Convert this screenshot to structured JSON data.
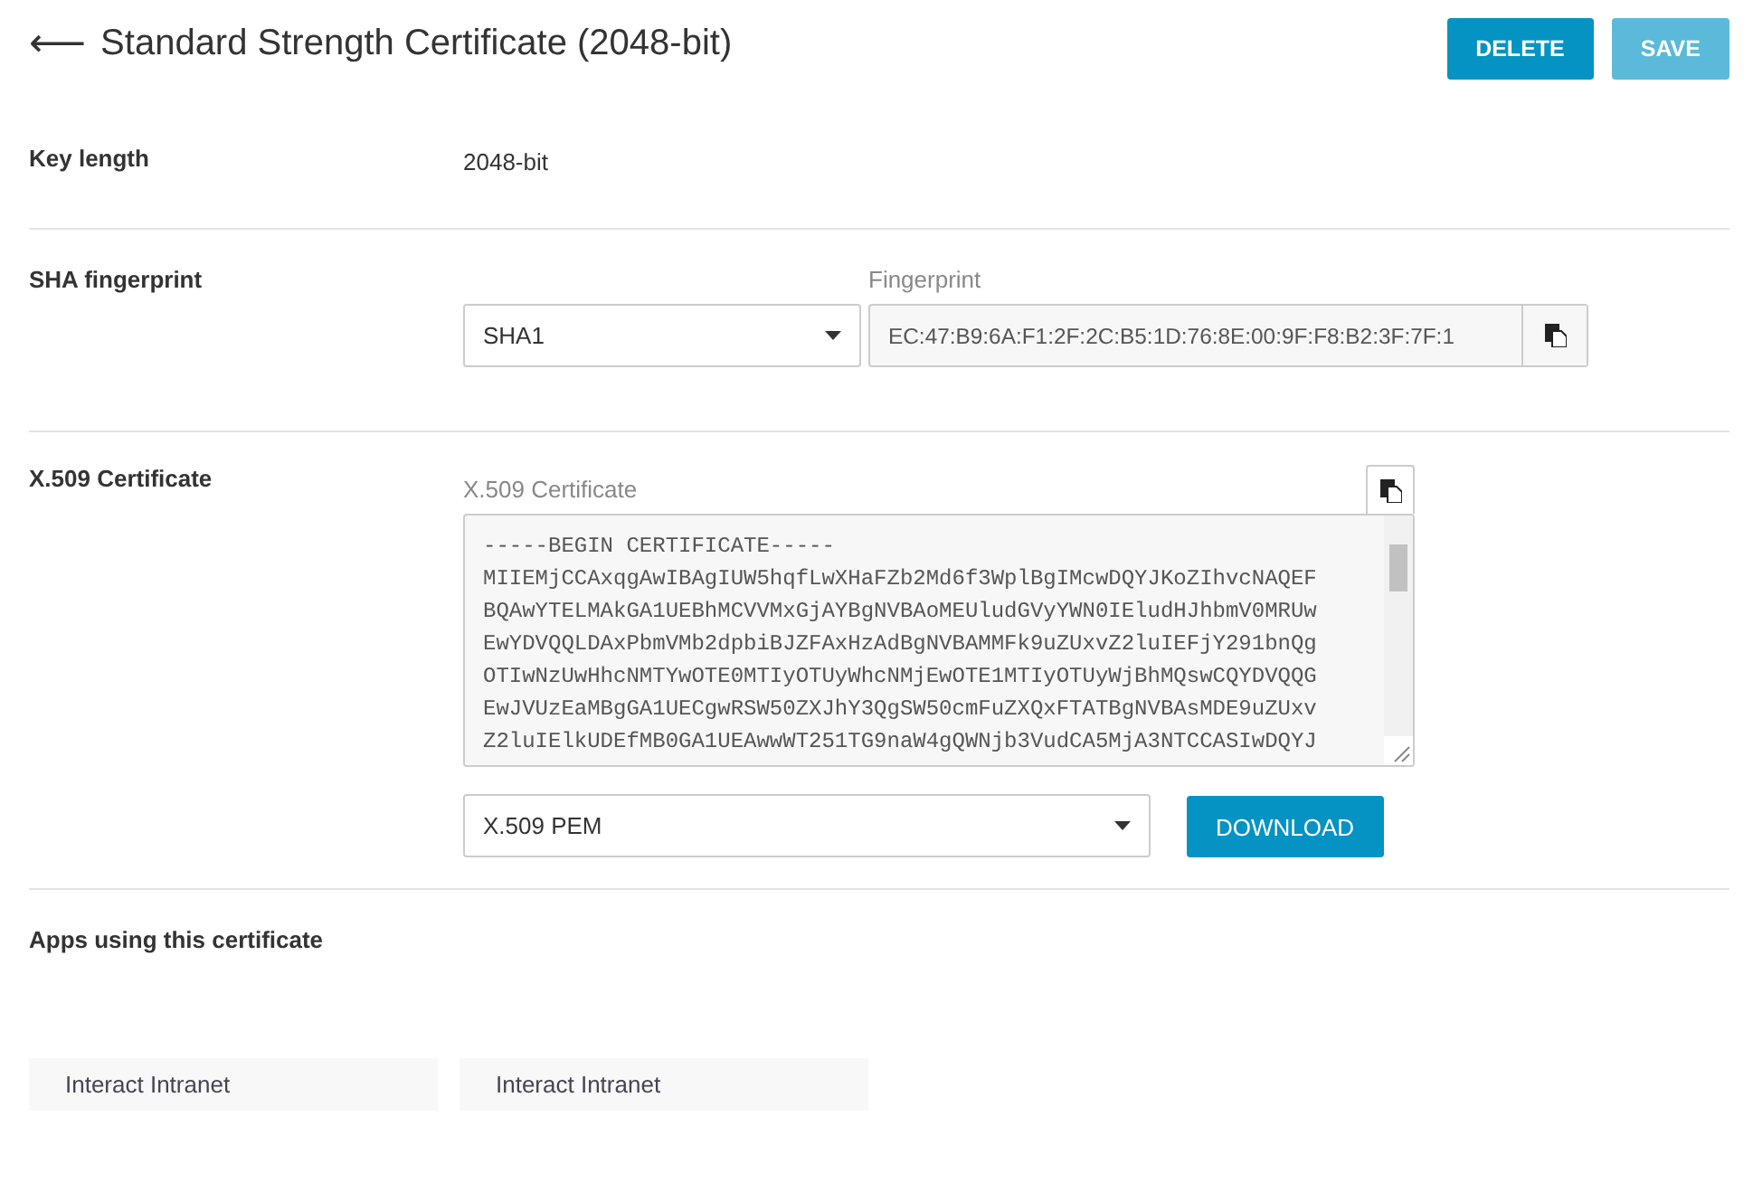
{
  "header": {
    "back_icon": "⟵",
    "title": "Standard Strength Certificate (2048-bit)",
    "buttons": [
      {
        "label": "DELETE",
        "disabled": false
      },
      {
        "label": "SAVE",
        "disabled": true
      }
    ]
  },
  "key_length": {
    "label": "Key length",
    "value": "2048-bit"
  },
  "sha": {
    "label": "SHA fingerprint",
    "algorithm": "SHA1",
    "field_label": "Fingerprint",
    "value": "EC:47:B9:6A:F1:2F:2C:B5:1D:76:8E:00:9F:F8:B2:3F:7F:1"
  },
  "certificate": {
    "label": "X.509 Certificate",
    "field_label": "X.509 Certificate",
    "lines": [
      "-----BEGIN CERTIFICATE-----",
      "MIIEMjCCAxqgAwIBAgIUW5hqfLwXHaFZb2Md6f3WplBgIMcwDQYJKoZIhvcNAQEF",
      "BQAwYTELMAkGA1UEBhMCVVMxGjAYBgNVBAoMEUludGVyYWN0IEludHJhbmV0MRUw",
      "EwYDVQQLDAxPbmVMb2dpbiBJZFAxHzAdBgNVBAMMFk9uZUxvZ2luIEFjY291bnQg",
      "OTIwNzUwHhcNMTYwOTE0MTIyOTUyWhcNMjEwOTE1MTIyOTUyWjBhMQswCQYDVQQG",
      "EwJVUzEaMBgGA1UECgwRSW50ZXJhY3QgSW50cmFuZXQxFTATBgNVBAsMDE9uZUxv",
      "Z2luIElkUDEfMB0GA1UEAwwWT251TG9naW4gQWNjb3VudCA5MjA3NTCCASIwDQYJ"
    ],
    "format": "X.509 PEM",
    "download": "DOWNLOAD"
  },
  "apps": {
    "label": "Apps using this certificate",
    "items": [
      "Interact Intranet",
      "Interact Intranet"
    ]
  }
}
